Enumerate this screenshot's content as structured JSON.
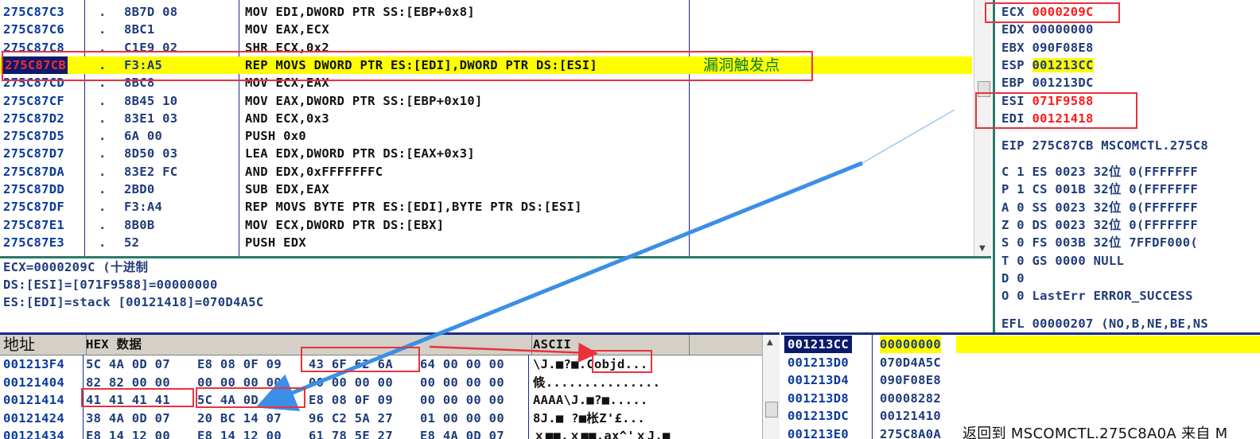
{
  "disasm": [
    {
      "addr": "275C87C3",
      "dot": ".",
      "hex": "8B7D 08",
      "ins": "MOV EDI,DWORD PTR SS:[EBP+0x8]"
    },
    {
      "addr": "275C87C6",
      "dot": ".",
      "hex": "8BC1",
      "ins": "MOV EAX,ECX"
    },
    {
      "addr": "275C87C8",
      "dot": ".",
      "hex": "C1E9 02",
      "ins": "SHR ECX,0x2"
    },
    {
      "addr": "275C87CB",
      "dot": ".",
      "hex": "F3:A5",
      "ins": "REP MOVS DWORD PTR ES:[EDI],DWORD PTR DS:[ESI]",
      "comment": "漏洞触发点"
    },
    {
      "addr": "275C87CD",
      "dot": ".",
      "hex": "8BC8",
      "ins": "MOV ECX,EAX"
    },
    {
      "addr": "275C87CF",
      "dot": ".",
      "hex": "8B45 10",
      "ins": "MOV EAX,DWORD PTR SS:[EBP+0x10]"
    },
    {
      "addr": "275C87D2",
      "dot": ".",
      "hex": "83E1 03",
      "ins": "AND ECX,0x3"
    },
    {
      "addr": "275C87D5",
      "dot": ".",
      "hex": "6A 00",
      "ins": "PUSH 0x0"
    },
    {
      "addr": "275C87D7",
      "dot": ".",
      "hex": "8D50 03",
      "ins": "LEA EDX,DWORD PTR DS:[EAX+0x3]"
    },
    {
      "addr": "275C87DA",
      "dot": ".",
      "hex": "83E2 FC",
      "ins": "AND EDX,0xFFFFFFFC"
    },
    {
      "addr": "275C87DD",
      "dot": ".",
      "hex": "2BD0",
      "ins": "SUB EDX,EAX"
    },
    {
      "addr": "275C87DF",
      "dot": ".",
      "hex": "F3:A4",
      "ins": "REP MOVS BYTE PTR ES:[EDI],BYTE PTR DS:[ESI]"
    },
    {
      "addr": "275C87E1",
      "dot": ".",
      "hex": "8B0B",
      "ins": "MOV ECX,DWORD PTR DS:[EBX]"
    },
    {
      "addr": "275C87E3",
      "dot": ".",
      "hex": "52",
      "ins": "PUSH EDX"
    }
  ],
  "registers": {
    "top": [
      {
        "name": "ECX",
        "value": "0000209C"
      },
      {
        "name": "EDX",
        "value": "00000000"
      },
      {
        "name": "EBX",
        "value": "090F08E8"
      },
      {
        "name": "ESP",
        "value": "001213CC"
      },
      {
        "name": "EBP",
        "value": "001213DC"
      },
      {
        "name": "ESI",
        "value": "071F9588"
      },
      {
        "name": "EDI",
        "value": "00121418"
      }
    ],
    "eip": "EIP 275C87CB MSCOMCTL.275C8",
    "flags": [
      "C 1  ES 0023 32位  0(FFFFFFF",
      "P 1  CS 001B 32位  0(FFFFFFF",
      "A 0  SS 0023 32位  0(FFFFFFF",
      "Z 0  DS 0023 32位  0(FFFFFFF",
      "S 0  FS 003B 32位  7FFDF000(",
      "T 0  GS 0000 NULL",
      "D 0",
      "O 0  LastErr ERROR_SUCCESS"
    ],
    "efl": "EFL 00000207 (NO,B,NE,BE,NS"
  },
  "info": [
    "ECX=0000209C (十进制",
    "DS:[ESI]=[071F9588]=00000000",
    "ES:[EDI]=stack [00121418]=070D4A5C"
  ],
  "dump": {
    "headers": {
      "addr": "地址",
      "hex": "HEX 数据",
      "ascii": "ASCII"
    },
    "rows": [
      {
        "a": "001213F4",
        "h1": "5C 4A 0D 07",
        "h2": "E8 08 0F 09",
        "h3": "43 6F 62 6A",
        "h4": "64 00 00 00",
        "asc": "\\J.■?■.Cobjd..."
      },
      {
        "a": "00121404",
        "h1": "82 82 00 00",
        "h2": "00 00 00 00",
        "h3": "00 00 00 00",
        "h4": "00 00 00 00",
        "asc": "倐..............."
      },
      {
        "a": "00121414",
        "h1": "41 41 41 41",
        "h2": "5C 4A 0D 07",
        "h3": "E8 08 0F 09",
        "h4": "00 00 00 00",
        "asc": "AAAA\\J.■?■....."
      },
      {
        "a": "00121424",
        "h1": "38 4A 0D 07",
        "h2": "20 BC 14 07",
        "h3": "96 C2 5A 27",
        "h4": "01 00 00 00",
        "asc": "8J.■ ?■枨Z'£..."
      },
      {
        "a": "00121434",
        "h1": "E8 14 12 00",
        "h2": "E8 14 12 00",
        "h3": "61 78 5E 27",
        "h4": "E8 4A 0D 07",
        "asc": "ｘ■■.ｘ■■.ax^'ｘJ.■"
      }
    ]
  },
  "stack": [
    {
      "a": "001213CC",
      "v": "00000000",
      "c": ""
    },
    {
      "a": "001213D0",
      "v": "070D4A5C",
      "c": ""
    },
    {
      "a": "001213D4",
      "v": "090F08E8",
      "c": ""
    },
    {
      "a": "001213D8",
      "v": "00008282",
      "c": ""
    },
    {
      "a": "001213DC",
      "v": "00121410",
      "c": ""
    },
    {
      "a": "001213E0",
      "v": "275C8A0A",
      "c": "返回到 MSCOMCTL.275C8A0A 来自 M"
    }
  ],
  "colors": {
    "accent_red": "#e8323c",
    "highlight": "#ffff00",
    "arrow_blue": "#3a8fe8"
  }
}
